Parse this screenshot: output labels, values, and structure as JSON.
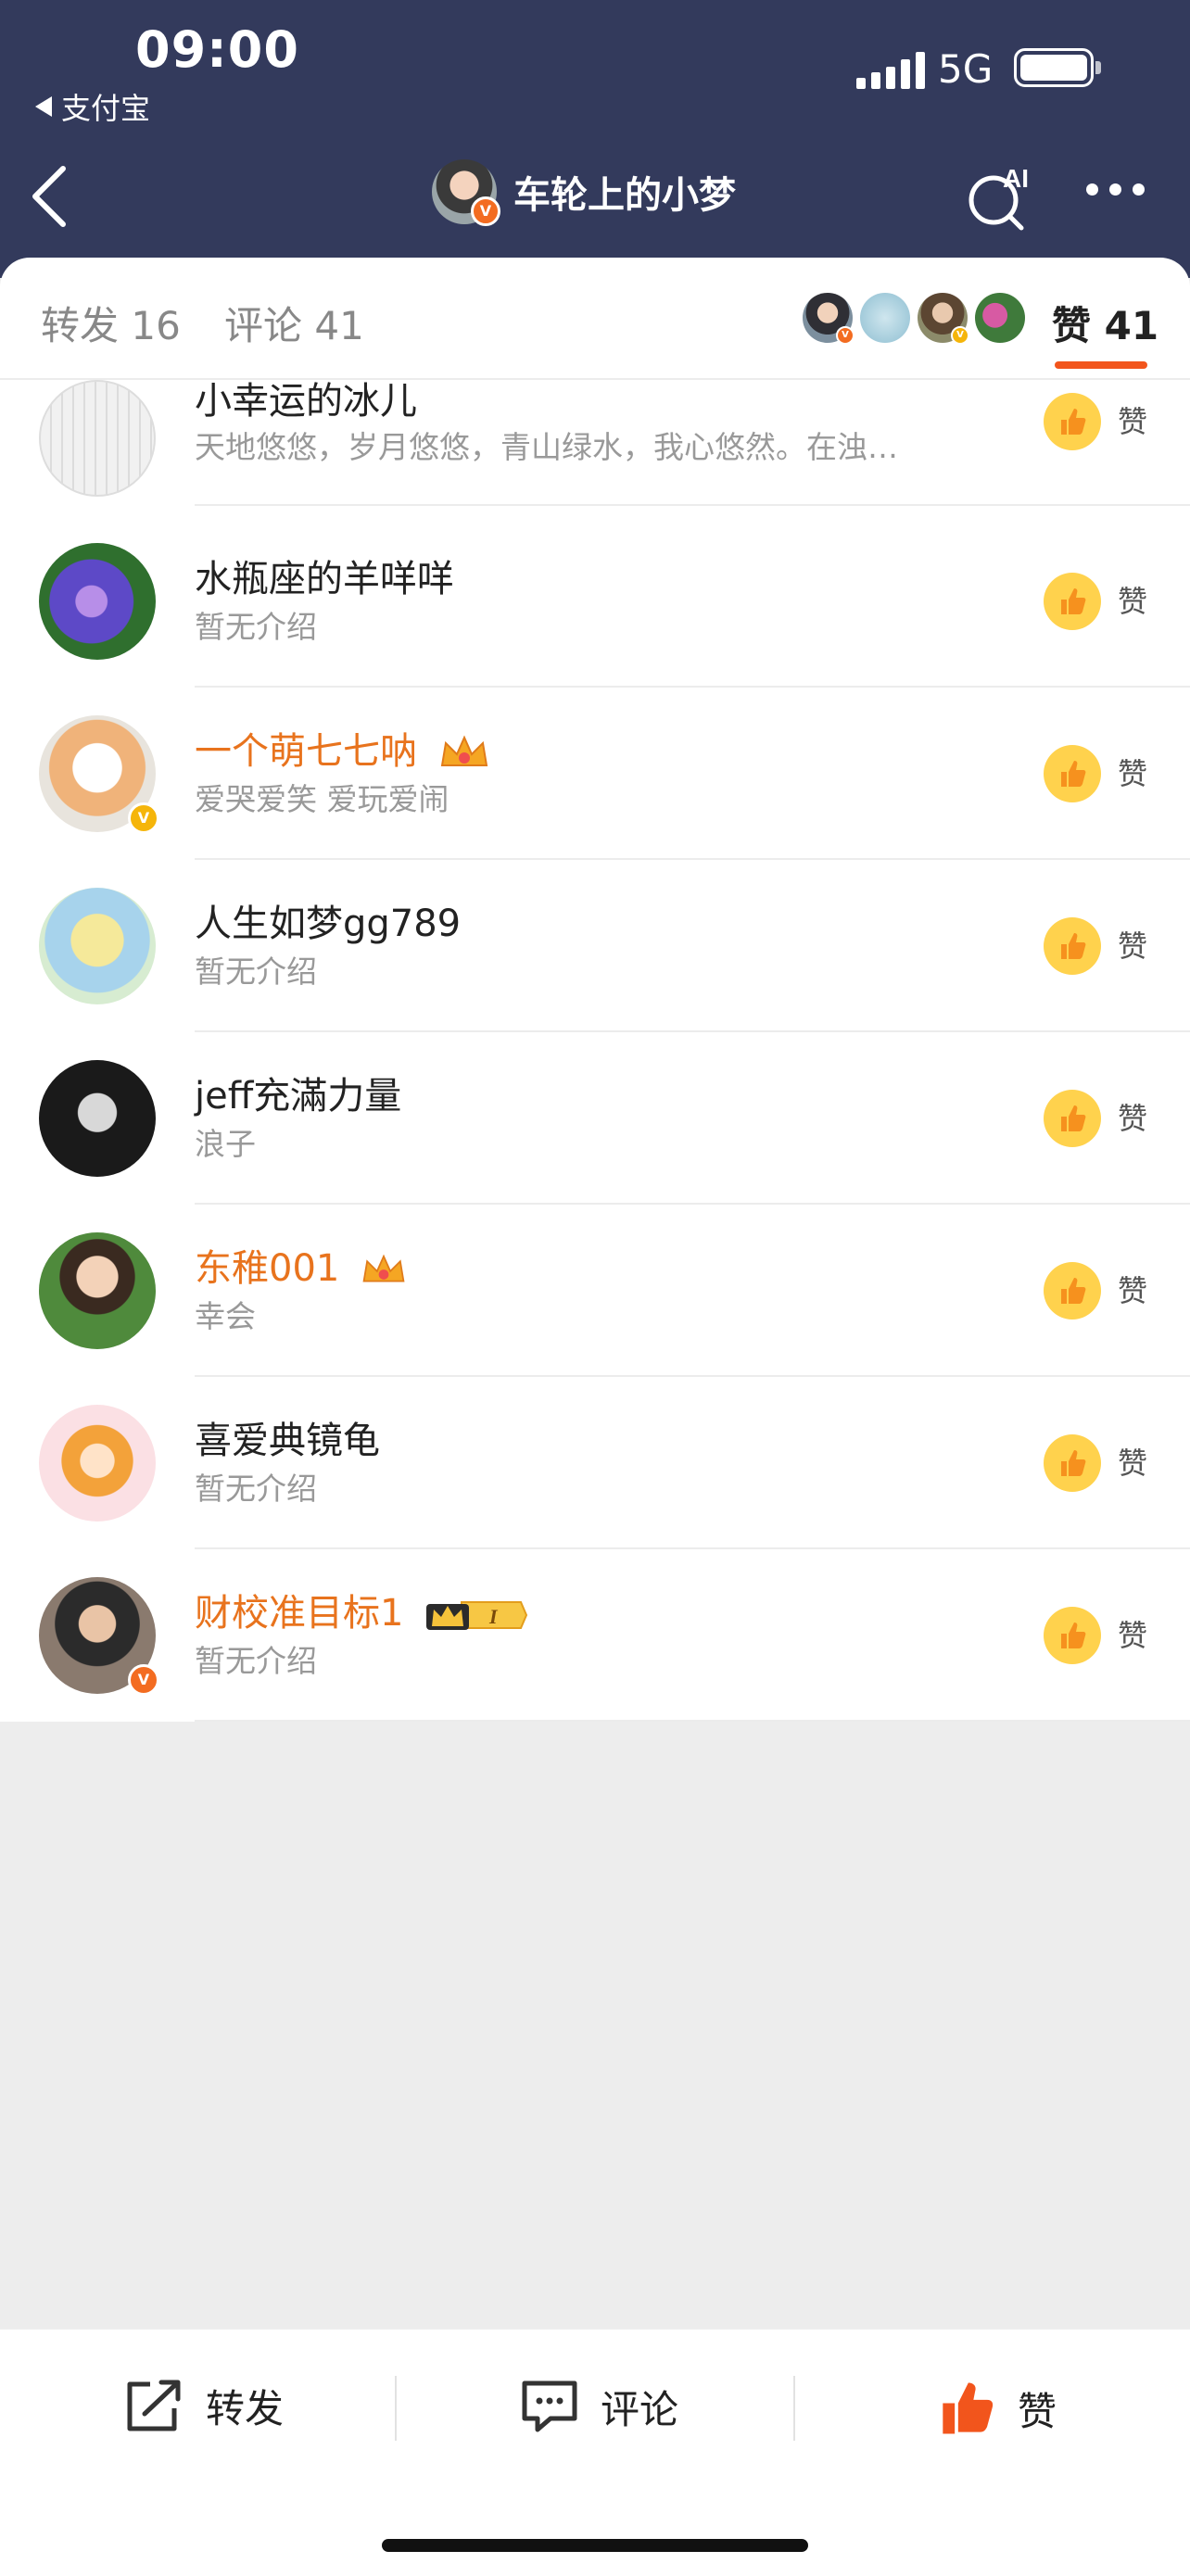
{
  "status_bar": {
    "time": "09:00",
    "back_app": "支付宝",
    "network": "5G"
  },
  "nav": {
    "title": "车轮上的小梦"
  },
  "tabs": {
    "repost": "转发 16",
    "comment": "评论 41",
    "like": "赞 41"
  },
  "likers": [
    {
      "name": "小幸运的冰儿",
      "desc": "天地悠悠，岁月悠悠，青山绿水，我心悠然。在浊…",
      "vip": false,
      "verified": false,
      "crown": false,
      "like_label": "赞"
    },
    {
      "name": "水瓶座的羊咩咩",
      "desc": "暂无介绍",
      "vip": false,
      "verified": false,
      "crown": false,
      "like_label": "赞"
    },
    {
      "name": "一个萌七七呐",
      "desc": "爱哭爱笑 爱玩爱闹",
      "vip": true,
      "verified": true,
      "crown": true,
      "like_label": "赞"
    },
    {
      "name": "人生如梦gg789",
      "desc": "暂无介绍",
      "vip": false,
      "verified": false,
      "crown": false,
      "like_label": "赞"
    },
    {
      "name": "jeff充滿力量",
      "desc": "浪子",
      "vip": false,
      "verified": false,
      "crown": false,
      "like_label": "赞"
    },
    {
      "name": "东稚001",
      "desc": "幸会",
      "vip": true,
      "verified": false,
      "crown": true,
      "like_label": "赞"
    },
    {
      "name": "喜爱典镜龟",
      "desc": "暂无介绍",
      "vip": false,
      "verified": false,
      "crown": false,
      "like_label": "赞"
    },
    {
      "name": "财校准目标1",
      "desc": "暂无介绍",
      "vip": true,
      "verified": true,
      "crown": true,
      "level_badge": "I",
      "like_label": "赞"
    }
  ],
  "bottom_bar": {
    "repost": "转发",
    "comment": "评论",
    "like": "赞"
  },
  "colors": {
    "header_bg": "#333a5c",
    "accent_orange": "#f2551c",
    "vip_name": "#e8731d",
    "like_yellow": "#ffd24d"
  },
  "icons": [
    "chevron-left-icon",
    "ai-search-icon",
    "more-icon",
    "thumb-up-icon",
    "share-icon",
    "comment-icon",
    "verified-badge-icon",
    "crown-icon"
  ]
}
